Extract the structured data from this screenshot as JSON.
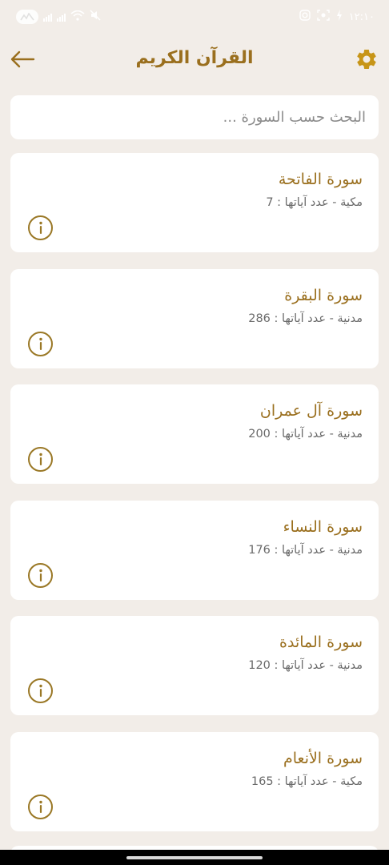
{
  "status": {
    "time": "١٢:١٠"
  },
  "header": {
    "title": "القرآن الكريم",
    "back_icon": "arrow-left-icon",
    "settings_icon": "gear-icon"
  },
  "search": {
    "placeholder": "البحث حسب السورة ..."
  },
  "colors": {
    "accent": "#9a6f1e",
    "background": "#f2ede8",
    "card": "#ffffff",
    "meta_text": "#6a6a6a"
  },
  "surahs": [
    {
      "name": "سورة الفاتحة",
      "meta": "مكية - عدد آياتها : 7"
    },
    {
      "name": "سورة البقرة",
      "meta": "مدنية - عدد آياتها : 286"
    },
    {
      "name": "سورة آل عمران",
      "meta": "مدنية - عدد آياتها : 200"
    },
    {
      "name": "سورة النساء",
      "meta": "مدنية - عدد آياتها : 176"
    },
    {
      "name": "سورة المائدة",
      "meta": "مدنية - عدد آياتها : 120"
    },
    {
      "name": "سورة الأنعام",
      "meta": "مكية - عدد آياتها : 165"
    }
  ]
}
